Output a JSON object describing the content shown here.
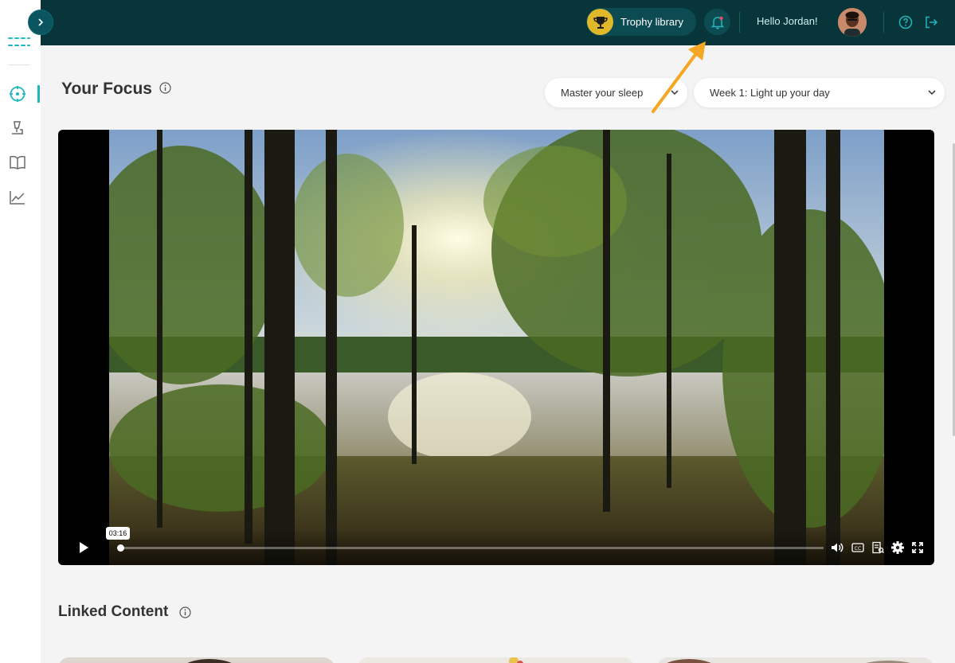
{
  "colors": {
    "header_bg": "#07353a",
    "accent": "#1fb7c0",
    "trophy_gold": "#e0b92a",
    "annotation_arrow": "#f5a623"
  },
  "sidebar": {
    "logo_icon": "brand-logo-icon",
    "toggle_icon": "chevron-right-icon",
    "items": [
      {
        "icon": "target-icon",
        "active": true
      },
      {
        "icon": "lamp-icon",
        "active": false
      },
      {
        "icon": "book-icon",
        "active": false
      },
      {
        "icon": "chart-icon",
        "active": false
      }
    ]
  },
  "header": {
    "trophy_label": "Trophy library",
    "trophy_icon": "trophy-icon",
    "notification_icon": "bell-icon",
    "greeting": "Hello Jordan!",
    "help_icon": "help-icon",
    "logout_icon": "logout-icon"
  },
  "main": {
    "title": "Your Focus",
    "program_select": "Master your sleep",
    "week_select": "Week 1: Light up your day",
    "video": {
      "time_tooltip": "03:16",
      "progress": 0.0,
      "controls": [
        "play-icon",
        "volume-icon",
        "captions-icon",
        "transcript-icon",
        "settings-icon",
        "fullscreen-icon"
      ]
    },
    "linked_title": "Linked Content"
  }
}
